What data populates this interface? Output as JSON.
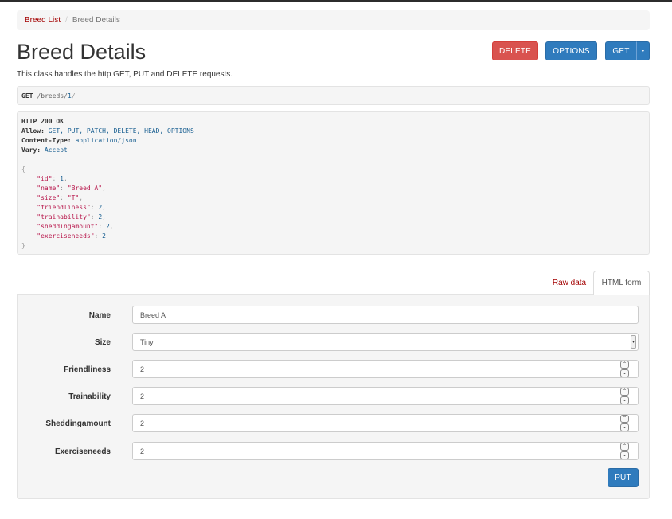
{
  "breadcrumb": {
    "items": [
      "Breed List",
      "Breed Details"
    ],
    "separator": "/"
  },
  "page": {
    "title": "Breed Details",
    "description": "This class handles the http GET, PUT and DELETE requests."
  },
  "actions": {
    "delete_label": "DELETE",
    "options_label": "OPTIONS",
    "get_label": "GET",
    "get_caret": "▾"
  },
  "request": {
    "method": "GET",
    "path_prefix": "/breeds/",
    "path_id": "1",
    "path_suffix": "/"
  },
  "response": {
    "status": "HTTP 200 OK",
    "headers": [
      {
        "key": "Allow:",
        "value": "GET, PUT, PATCH, DELETE, HEAD, OPTIONS"
      },
      {
        "key": "Content-Type:",
        "value": "application/json"
      },
      {
        "key": "Vary:",
        "value": "Accept"
      }
    ],
    "body": [
      {
        "key": "\"id\"",
        "value": "1",
        "kind": "num",
        "comma": ","
      },
      {
        "key": "\"name\"",
        "value": "\"Breed A\"",
        "kind": "str",
        "comma": ","
      },
      {
        "key": "\"size\"",
        "value": "\"T\"",
        "kind": "str",
        "comma": ","
      },
      {
        "key": "\"friendliness\"",
        "value": "2",
        "kind": "num",
        "comma": ","
      },
      {
        "key": "\"trainability\"",
        "value": "2",
        "kind": "num",
        "comma": ","
      },
      {
        "key": "\"sheddingamount\"",
        "value": "2",
        "kind": "num",
        "comma": ","
      },
      {
        "key": "\"exerciseneeds\"",
        "value": "2",
        "kind": "num",
        "comma": ""
      }
    ]
  },
  "tabs": {
    "raw_label": "Raw data",
    "html_label": "HTML form",
    "active": "HTML form"
  },
  "form": {
    "fields": [
      {
        "label": "Name",
        "value": "Breed A",
        "type": "text"
      },
      {
        "label": "Size",
        "value": "Tiny",
        "type": "select"
      },
      {
        "label": "Friendliness",
        "value": "2",
        "type": "number"
      },
      {
        "label": "Trainability",
        "value": "2",
        "type": "number"
      },
      {
        "label": "Sheddingamount",
        "value": "2",
        "type": "number"
      },
      {
        "label": "Exerciseneeds",
        "value": "2",
        "type": "number"
      }
    ],
    "submit_label": "PUT",
    "spin_up": "⌃",
    "spin_down": "⌄",
    "select_arrow": "▾"
  },
  "colors": {
    "link": "#a30000",
    "primary": "#2f7bbd",
    "danger": "#d9534f",
    "json_key": "#b8174c",
    "json_value": "#195f91"
  },
  "icons": [
    "caret-down-icon",
    "spinner-up-icon",
    "spinner-down-icon",
    "select-arrow-icon"
  ]
}
